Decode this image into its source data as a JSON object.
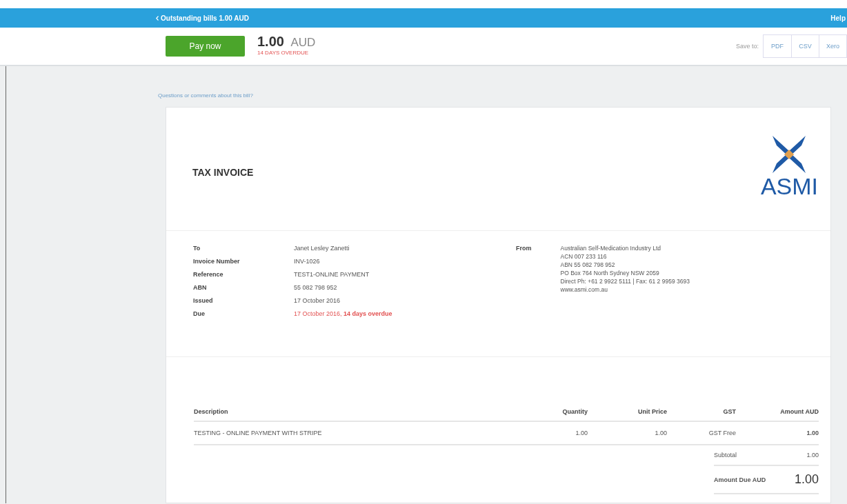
{
  "top_bar": {
    "title": "Outstanding bills 1.00 AUD",
    "help": "Help"
  },
  "header": {
    "pay_button": "Pay now",
    "amount": "1.00",
    "currency": "AUD",
    "overdue": "14 DAYS OVERDUE",
    "save_to": "Save to:",
    "formats": [
      "PDF",
      "CSV",
      "Xero"
    ]
  },
  "questions_link": "Questions or comments about this bill?",
  "invoice": {
    "title": "TAX INVOICE",
    "logo_text": "ASMI",
    "details": [
      {
        "label": "To",
        "value": "Janet Lesley Zanetti",
        "overdue": false
      },
      {
        "label": "Invoice Number",
        "value": "INV-1026",
        "overdue": false
      },
      {
        "label": "Reference",
        "value": "TEST1-ONLINE PAYMENT",
        "overdue": false
      },
      {
        "label": "ABN",
        "value": "55 082 798 952",
        "overdue": false
      },
      {
        "label": "Issued",
        "value": "17 October 2016",
        "overdue": false
      },
      {
        "label": "Due",
        "value": "17 October 2016, **14 days overdue**",
        "overdue": true
      }
    ],
    "from_label": "From",
    "from_lines": [
      "Australian Self-Medication Industry Ltd",
      "ACN 007 233 116",
      "ABN 55 082 798 952",
      "PO Box 764 North Sydney NSW 2059",
      "Direct Ph: +61 2 9922 5111 | Fax: 61 2 9959 3693",
      "www.asmi.com.au"
    ],
    "columns": [
      "Description",
      "Quantity",
      "Unit Price",
      "GST",
      "Amount AUD"
    ],
    "rows": [
      [
        "TESTING - ONLINE PAYMENT WITH STRIPE",
        "1.00",
        "1.00",
        "GST Free",
        "1.00"
      ]
    ],
    "subtotal_label": "Subtotal",
    "subtotal": "1.00",
    "amount_due_label": "Amount Due AUD",
    "amount_due": "1.00"
  }
}
